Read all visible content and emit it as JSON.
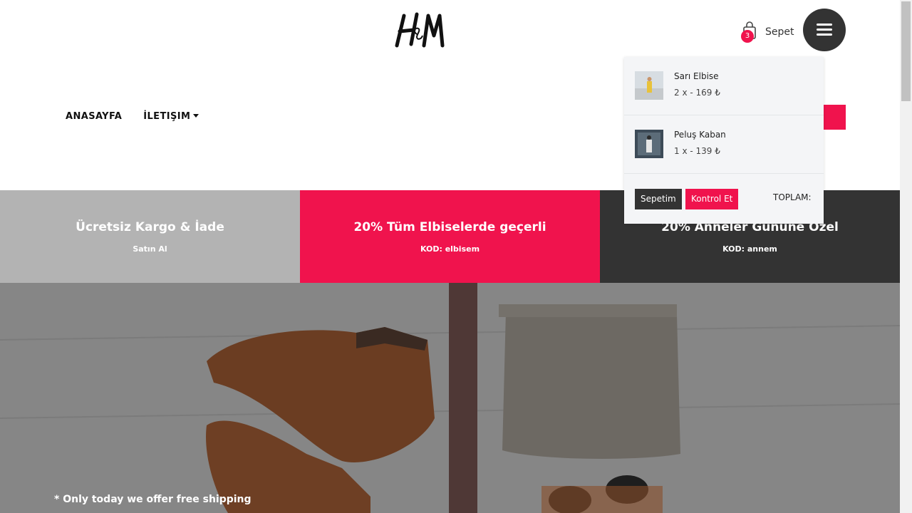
{
  "brand": {
    "logo_text": "H&M"
  },
  "header": {
    "cart": {
      "count": "3",
      "label": "Sepet"
    }
  },
  "nav": {
    "items": [
      {
        "label": "ANASAYFA"
      },
      {
        "label": "İLETIŞIM"
      }
    ]
  },
  "cart_dropdown": {
    "items": [
      {
        "name": "Sarı Elbise",
        "qty_price": "2 x - 169 ₺"
      },
      {
        "name": "Peluş Kaban",
        "qty_price": "1 x - 139 ₺"
      }
    ],
    "buttons": {
      "cart": "Sepetim",
      "checkout": "Kontrol Et"
    },
    "total_label": "TOPLAM:"
  },
  "promos": [
    {
      "title": "Ücretsiz Kargo & İade",
      "subtitle": "Satın Al"
    },
    {
      "title": "20% Tüm Elbiselerde geçerli",
      "subtitle": "KOD: elbisem"
    },
    {
      "title": "20% Anneler Gününe Özel",
      "subtitle": "KOD: annem"
    }
  ],
  "hero": {
    "caption": "* Only today we offer free shipping"
  },
  "colors": {
    "accent": "#f0134d",
    "dark": "#333333",
    "light_gray": "#b3b3b3"
  }
}
